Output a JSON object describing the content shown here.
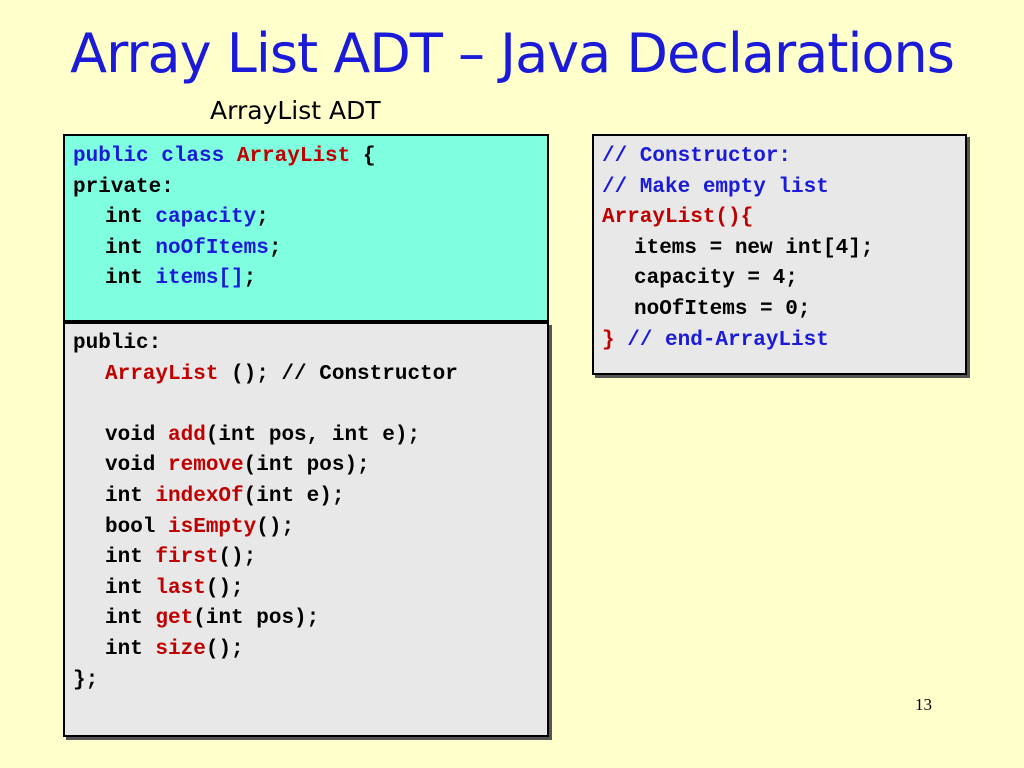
{
  "slide": {
    "title": "Array List ADT – Java Declarations",
    "subtitle": "ArrayList ADT",
    "page_number": "13"
  },
  "private_block": {
    "l1": {
      "a": "public class",
      "b": "ArrayList",
      "c": " {"
    },
    "l2": {
      "a": "private:"
    },
    "l3": {
      "a": "int ",
      "b": "capacity",
      "c": ";"
    },
    "l4": {
      "a": "int ",
      "b": "noOfItems",
      "c": ";"
    },
    "l5": {
      "a": "int ",
      "b": "items[]",
      "c": ";"
    }
  },
  "public_block": {
    "l1": {
      "a": "public:"
    },
    "l2": {
      "a": "ArrayList",
      "b": " (); // Constructor"
    },
    "l3": {
      "a": ""
    },
    "l4": {
      "a": "void ",
      "b": "add",
      "c": "(int pos, int e);"
    },
    "l5": {
      "a": "void ",
      "b": "remove",
      "c": "(int pos);"
    },
    "l6": {
      "a": "int ",
      "b": "indexOf",
      "c": "(int e);"
    },
    "l7": {
      "a": "bool ",
      "b": "isEmpty",
      "c": "();"
    },
    "l8": {
      "a": "int ",
      "b": "first",
      "c": "();"
    },
    "l9": {
      "a": "int ",
      "b": "last",
      "c": "();"
    },
    "l10": {
      "a": "int ",
      "b": "get",
      "c": "(int pos);"
    },
    "l11": {
      "a": "int ",
      "b": "size",
      "c": "();"
    },
    "l12": {
      "a": "};"
    }
  },
  "constructor_block": {
    "l1": {
      "a": "// Constructor:"
    },
    "l2": {
      "a": "// Make empty list"
    },
    "l3": {
      "a": "ArrayList(){"
    },
    "l4": {
      "a": "items = new int[4];"
    },
    "l5": {
      "a": "capacity = 4;"
    },
    "l6": {
      "a": "noOfItems = 0;"
    },
    "l7": {
      "a": "}",
      "b": " // end-ArrayList"
    }
  },
  "colors": {
    "background": "#FFFFCC",
    "title": "#1a1ad8",
    "keyword_blue": "#1a1ad8",
    "identifier_red": "#c00000",
    "private_box": "#80FFE0",
    "code_box": "#E8E8E8"
  }
}
